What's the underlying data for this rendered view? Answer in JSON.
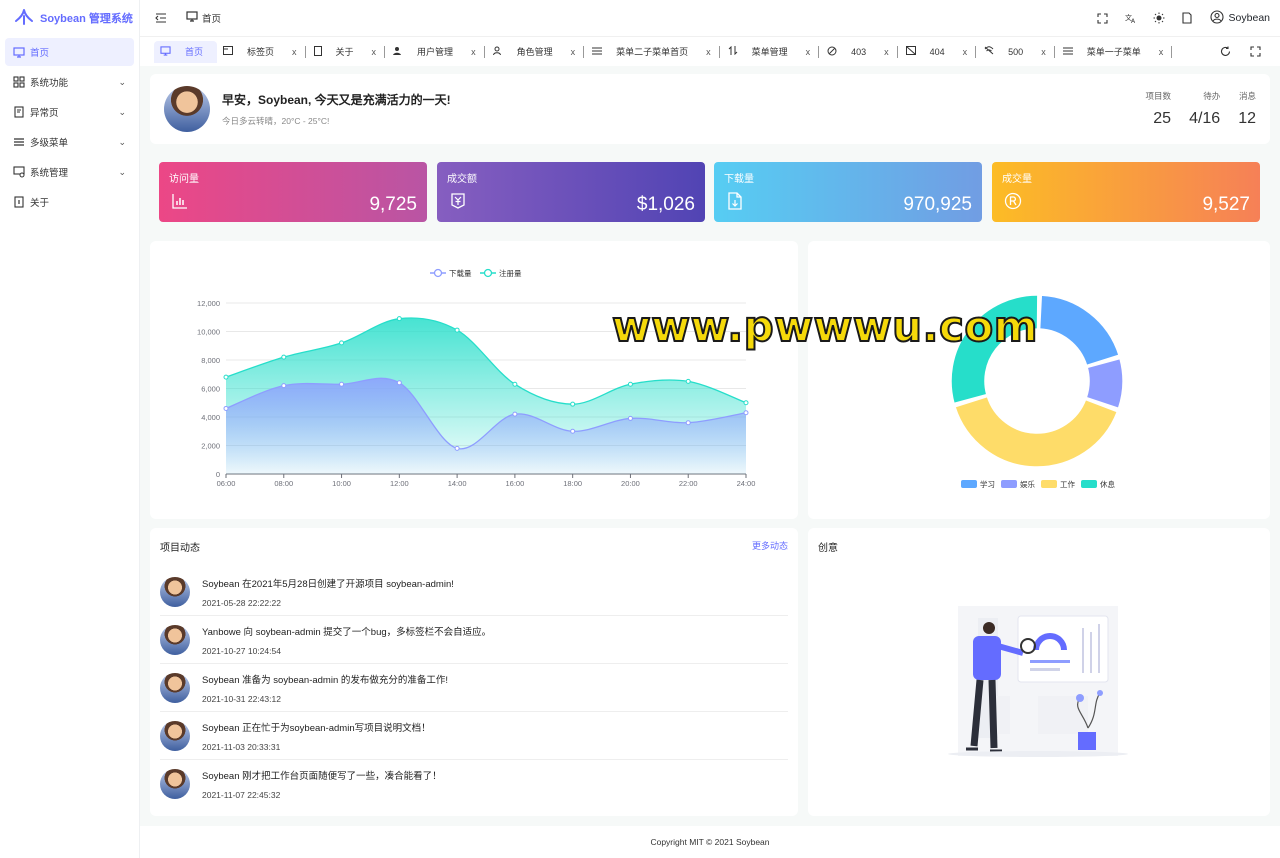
{
  "app": {
    "title": "Soybean 管理系统"
  },
  "sidebar": {
    "items": [
      {
        "label": "首页",
        "icon": "monitor-icon",
        "active": true
      },
      {
        "label": "系统功能",
        "icon": "apps-icon",
        "expandable": true
      },
      {
        "label": "异常页",
        "icon": "exception-icon",
        "expandable": true
      },
      {
        "label": "多级菜单",
        "icon": "list-icon",
        "expandable": true
      },
      {
        "label": "系统管理",
        "icon": "settings-screen-icon",
        "expandable": true
      },
      {
        "label": "关于",
        "icon": "info-icon"
      }
    ]
  },
  "header": {
    "breadcrumb": "首页",
    "username": "Soybean"
  },
  "tabs": [
    {
      "label": "首页",
      "active": true,
      "icon": "monitor-icon"
    },
    {
      "label": "标签页",
      "icon": "tab-icon",
      "closable": true
    },
    {
      "label": "关于",
      "icon": "tablet-icon",
      "closable": true
    },
    {
      "label": "用户管理",
      "icon": "users-icon",
      "closable": true
    },
    {
      "label": "角色管理",
      "icon": "user-role-icon",
      "closable": true
    },
    {
      "label": "菜单二子菜单首页",
      "icon": "list-icon",
      "closable": true
    },
    {
      "label": "菜单管理",
      "icon": "sort-icon",
      "closable": true
    },
    {
      "label": "403",
      "icon": "forbidden-icon",
      "closable": true
    },
    {
      "label": "404",
      "icon": "not-found-icon",
      "closable": true
    },
    {
      "label": "500",
      "icon": "wifi-off-icon",
      "closable": true
    },
    {
      "label": "菜单一子菜单",
      "icon": "list-icon",
      "closable": true
    }
  ],
  "tab_close": "x",
  "welcome": {
    "greeting": "早安，Soybean, 今天又是充满活力的一天!",
    "weather": "今日多云转晴，20°C - 25°C!",
    "stats": [
      {
        "label": "项目数",
        "value": "25"
      },
      {
        "label": "待办",
        "value": "4/16"
      },
      {
        "label": "消息",
        "value": "12"
      }
    ]
  },
  "metrics": [
    {
      "title": "访问量",
      "value": "9,725",
      "icon": "bar-chart-icon",
      "gradient": [
        "#ec4786",
        "#b955a4"
      ]
    },
    {
      "title": "成交额",
      "value": "$1,026",
      "icon": "yen-icon",
      "gradient": [
        "#865ec0",
        "#5144b4"
      ]
    },
    {
      "title": "下载量",
      "value": "970,925",
      "icon": "file-download-icon",
      "gradient": [
        "#56cdf3",
        "#719de3"
      ]
    },
    {
      "title": "成交量",
      "value": "9,527",
      "icon": "registered-icon",
      "gradient": [
        "#fcbc25",
        "#f68057"
      ]
    }
  ],
  "chart_data": [
    {
      "type": "area",
      "x": [
        "06:00",
        "08:00",
        "10:00",
        "12:00",
        "14:00",
        "16:00",
        "18:00",
        "20:00",
        "22:00",
        "24:00"
      ],
      "series": [
        {
          "name": "下载量",
          "values": [
            4600,
            6200,
            6300,
            6400,
            1800,
            4200,
            3000,
            3900,
            3600,
            4300
          ],
          "color": "#8e9dff"
        },
        {
          "name": "注册量",
          "values": [
            6800,
            8200,
            9200,
            10900,
            10100,
            6300,
            4900,
            6300,
            6500,
            5000
          ],
          "color": "#26deca"
        }
      ],
      "yticks": [
        "0",
        "2,000",
        "4,000",
        "6,000",
        "8,000",
        "10,000",
        "12,000"
      ],
      "ylim": [
        0,
        12000
      ],
      "legend": "top-center"
    },
    {
      "type": "pie",
      "categories": [
        "学习",
        "娱乐",
        "工作",
        "休息"
      ],
      "values": [
        20,
        10,
        40,
        30
      ],
      "colors": [
        "#5da8ff",
        "#8e9dff",
        "#fedc69",
        "#26deca"
      ],
      "legend": "bottom-center"
    }
  ],
  "activity": {
    "title": "项目动态",
    "more": "更多动态",
    "items": [
      {
        "title": "Soybean 在2021年5月28日创建了开源项目 soybean-admin!",
        "time": "2021-05-28 22:22:22"
      },
      {
        "title": "Yanbowe 向 soybean-admin 提交了一个bug，多标签栏不会自适应。",
        "time": "2021-10-27 10:24:54"
      },
      {
        "title": "Soybean 准备为 soybean-admin 的发布做充分的准备工作!",
        "time": "2021-10-31 22:43:12"
      },
      {
        "title": "Soybean 正在忙于为soybean-admin写项目说明文档！",
        "time": "2021-11-03 20:33:31"
      },
      {
        "title": "Soybean 刚才把工作台页面随便写了一些，凑合能看了！",
        "time": "2021-11-07 22:45:32"
      }
    ]
  },
  "creative": {
    "title": "创意"
  },
  "footer": {
    "text": "Copyright MIT © 2021 Soybean"
  },
  "watermark": "www.pwwwu.com"
}
